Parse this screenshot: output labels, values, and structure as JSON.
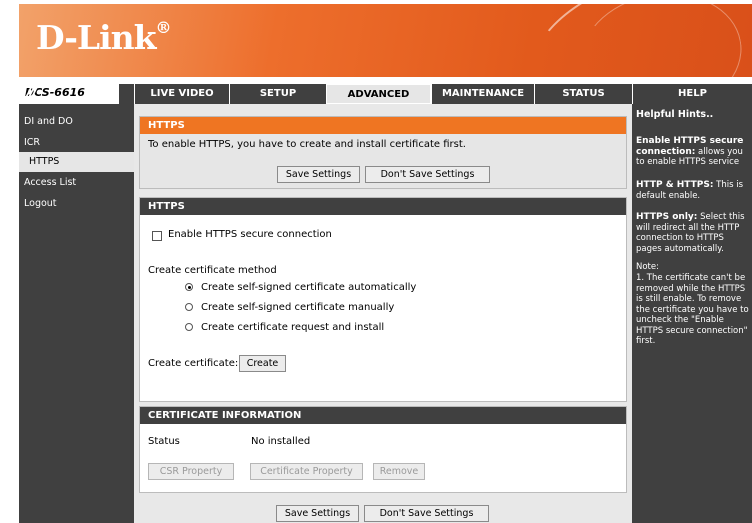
{
  "header": {
    "logo_text": "D-Link",
    "logo_mark": "®"
  },
  "nav": {
    "model": "DCS-6616",
    "tabs": [
      "LIVE VIDEO",
      "SETUP",
      "ADVANCED",
      "MAINTENANCE",
      "STATUS",
      "HELP"
    ],
    "active_tab": "ADVANCED"
  },
  "sidebar": {
    "items": [
      "DI and DO",
      "ICR",
      "HTTPS",
      "Access List",
      "Logout"
    ],
    "active_item": "HTTPS"
  },
  "main": {
    "top_section": {
      "title": "HTTPS",
      "message": "To enable HTTPS, you have to create and install certificate first.",
      "save_label": "Save Settings",
      "dont_save_label": "Don't Save Settings"
    },
    "https_section": {
      "title": "HTTPS",
      "enable_label": "Enable HTTPS secure connection",
      "enable_checked": false,
      "method_label": "Create certificate method",
      "methods": [
        "Create self-signed certificate automatically",
        "Create self-signed certificate manually",
        "Create certificate request and install"
      ],
      "selected_method_index": 0,
      "create_label": "Create certificate:",
      "create_button": "Create"
    },
    "cert_section": {
      "title": "CERTIFICATE INFORMATION",
      "status_label": "Status",
      "status_value": "No installed",
      "csr_button": "CSR Property",
      "cert_button": "Certificate Property",
      "remove_button": "Remove"
    },
    "bottom": {
      "save_label": "Save Settings",
      "dont_save_label": "Don't Save Settings"
    }
  },
  "hints": {
    "title": "Helpful Hints..",
    "p1_bold": "Enable HTTPS secure connection:",
    "p1_text": " allows you to enable HTTPS service",
    "p2_bold": "HTTP & HTTPS:",
    "p2_text": " This is default enable.",
    "p3_bold": "HTTPS only:",
    "p3_text": " Select this will redirect all the HTTP connection to HTTPS pages automatically.",
    "note_title": "Note:",
    "note_text": "1. The certificate can't be removed while the HTTPS is still enable. To remove the certificate you have to uncheck the \"Enable HTTPS secure connection\" first."
  },
  "colors": {
    "accent_orange": "#ef7522",
    "nav_dark": "#404040",
    "panel_grey": "#e8e8e8"
  }
}
